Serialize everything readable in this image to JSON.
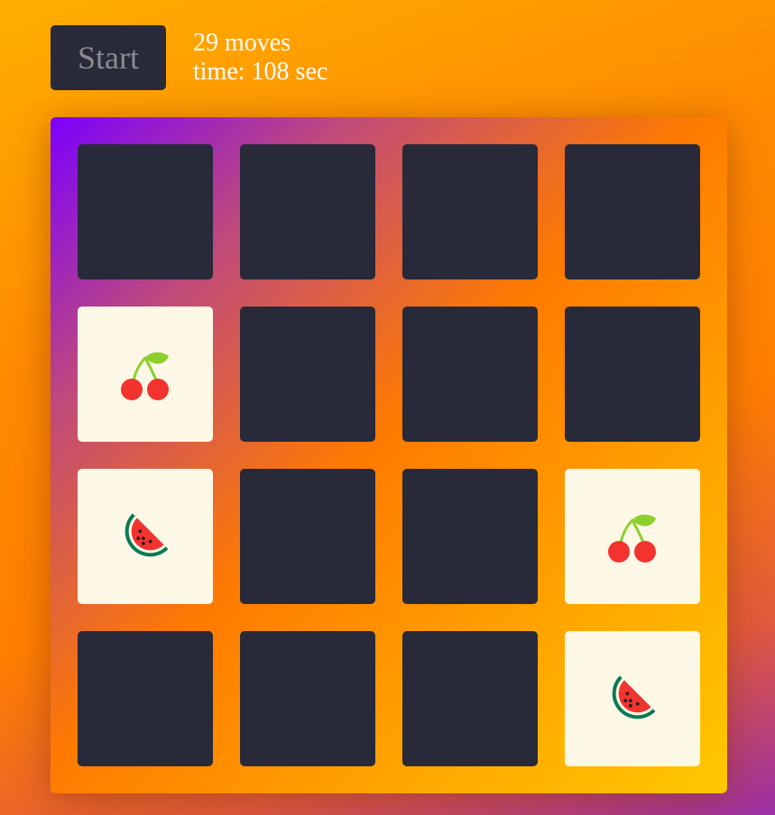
{
  "controls": {
    "start_label": "Start",
    "moves_text": "29 moves",
    "time_text": "time: 108 sec"
  },
  "board": {
    "rows": 4,
    "cols": 4,
    "cards": [
      {
        "row": 0,
        "col": 0,
        "state": "hidden",
        "fruit": ""
      },
      {
        "row": 0,
        "col": 1,
        "state": "hidden",
        "fruit": ""
      },
      {
        "row": 0,
        "col": 2,
        "state": "hidden",
        "fruit": ""
      },
      {
        "row": 0,
        "col": 3,
        "state": "hidden",
        "fruit": ""
      },
      {
        "row": 1,
        "col": 0,
        "state": "flipped",
        "fruit": "cherry-icon"
      },
      {
        "row": 1,
        "col": 1,
        "state": "hidden",
        "fruit": ""
      },
      {
        "row": 1,
        "col": 2,
        "state": "hidden",
        "fruit": ""
      },
      {
        "row": 1,
        "col": 3,
        "state": "hidden",
        "fruit": ""
      },
      {
        "row": 2,
        "col": 0,
        "state": "flipped",
        "fruit": "watermelon-icon"
      },
      {
        "row": 2,
        "col": 1,
        "state": "hidden",
        "fruit": ""
      },
      {
        "row": 2,
        "col": 2,
        "state": "hidden",
        "fruit": ""
      },
      {
        "row": 2,
        "col": 3,
        "state": "flipped",
        "fruit": "cherry-icon"
      },
      {
        "row": 3,
        "col": 0,
        "state": "hidden",
        "fruit": ""
      },
      {
        "row": 3,
        "col": 1,
        "state": "hidden",
        "fruit": ""
      },
      {
        "row": 3,
        "col": 2,
        "state": "hidden",
        "fruit": ""
      },
      {
        "row": 3,
        "col": 3,
        "state": "flipped",
        "fruit": "watermelon-icon"
      }
    ]
  },
  "colors": {
    "card_back": "#282a3a",
    "card_face": "#fdf8e6",
    "cherry_red": "#f2332e",
    "cherry_stem": "#8ccf2e",
    "watermelon_rind": "#0b7a55",
    "watermelon_flesh": "#f2332e"
  }
}
